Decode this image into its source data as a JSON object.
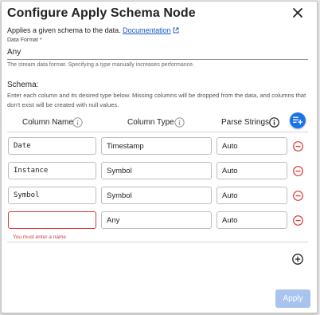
{
  "dialog": {
    "title": "Configure Apply Schema Node",
    "subtitle": "Applies a given schema to the data.",
    "doc_link": "Documentation"
  },
  "data_format": {
    "label": "Data Format *",
    "value": "Any",
    "help": "The stream data format. Specifying a type manually increases performance."
  },
  "schema": {
    "label": "Schema:",
    "description": "Enter each column and its desired type below. Missing columns will be dropped from the data, and columns that don't exist will be created with null values.",
    "headers": {
      "column_name": "Column Name",
      "column_type": "Column Type",
      "parse_strings": "Parse Strings"
    },
    "rows": [
      {
        "name": "Date",
        "type": "Timestamp",
        "parse": "Auto"
      },
      {
        "name": "Instance",
        "type": "Symbol",
        "parse": "Auto"
      },
      {
        "name": "Symbol",
        "type": "Symbol",
        "parse": "Auto"
      },
      {
        "name": "",
        "type": "Any",
        "parse": "Auto"
      }
    ],
    "error": "You must enter a name"
  },
  "actions": {
    "apply": "Apply"
  },
  "colors": {
    "primary": "#1a73e8",
    "error": "#d93a3a",
    "apply_disabled": "#a7c3ee",
    "link": "#1a55c8"
  },
  "icons": [
    "close-icon",
    "external-link-icon",
    "info-icon",
    "add-column-icon",
    "remove-row-icon",
    "add-row-icon"
  ]
}
